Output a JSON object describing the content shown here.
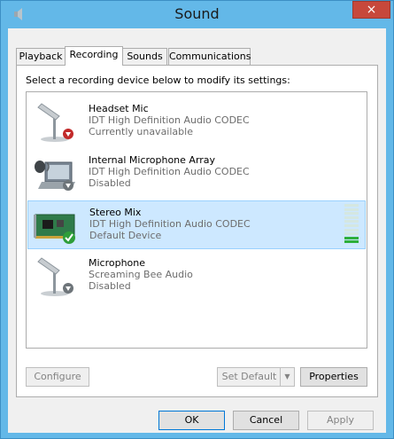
{
  "window": {
    "title": "Sound",
    "close_glyph": "×",
    "icon": "speaker-icon"
  },
  "tabs": [
    {
      "label": "Playback",
      "active": false
    },
    {
      "label": "Recording",
      "active": true
    },
    {
      "label": "Sounds",
      "active": false
    },
    {
      "label": "Communications",
      "active": false
    }
  ],
  "instruction": "Select a recording device below to modify its settings:",
  "devices": [
    {
      "name": "Headset Mic",
      "driver": "IDT High Definition Audio CODEC",
      "status": "Currently unavailable",
      "icon": "microphone-icon",
      "badge": "unplugged-badge-icon",
      "selected": false
    },
    {
      "name": "Internal Microphone Array",
      "driver": "IDT High Definition Audio CODEC",
      "status": "Disabled",
      "icon": "laptop-microphone-icon",
      "badge": "disabled-badge-icon",
      "selected": false
    },
    {
      "name": "Stereo Mix",
      "driver": "IDT High Definition Audio CODEC",
      "status": "Default Device",
      "icon": "sound-card-icon",
      "badge": "default-check-icon",
      "selected": true,
      "level_segments_total": 10,
      "level_segments_on": 2
    },
    {
      "name": "Microphone",
      "driver": "Screaming Bee Audio",
      "status": "Disabled",
      "icon": "microphone-icon",
      "badge": "disabled-badge-icon",
      "selected": false
    }
  ],
  "buttons": {
    "configure": "Configure",
    "set_default": "Set Default",
    "set_default_arrow": "▼",
    "properties": "Properties",
    "ok": "OK",
    "cancel": "Cancel",
    "apply": "Apply"
  },
  "colors": {
    "frame": "#63b8e8",
    "close": "#c7483b",
    "selection": "#cde8ff",
    "level_on": "#2eaf3c",
    "level_off": "#d4e7e1"
  }
}
